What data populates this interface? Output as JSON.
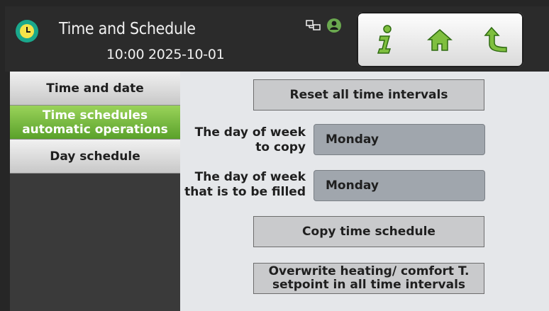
{
  "header": {
    "title": "Time and Schedule",
    "time": "10:00",
    "date": "2025-10-01"
  },
  "toolbar": {
    "info_icon": "info-icon",
    "home_icon": "home-icon",
    "back_icon": "back-arrow-icon"
  },
  "sidebar": {
    "items": [
      {
        "label": "Time and date",
        "active": false
      },
      {
        "label_line1": "Time schedules",
        "label_line2": "automatic operations",
        "active": true
      },
      {
        "label": "Day schedule",
        "active": false
      }
    ]
  },
  "main": {
    "reset_button": "Reset all time intervals",
    "copy_from_label_line1": "The day of week",
    "copy_from_label_line2": "to copy",
    "copy_from_value": "Monday",
    "fill_label_line1": "The day of week",
    "fill_label_line2": "that is to be filled",
    "fill_value": "Monday",
    "copy_button": "Copy time schedule",
    "overwrite_button_line1": "Overwrite heating/ comfort T.",
    "overwrite_button_line2": "setpoint in all time intervals"
  },
  "colors": {
    "accent_green": "#6db33f",
    "header_bg": "#2b2b2b",
    "content_bg": "#e5e7ea"
  }
}
